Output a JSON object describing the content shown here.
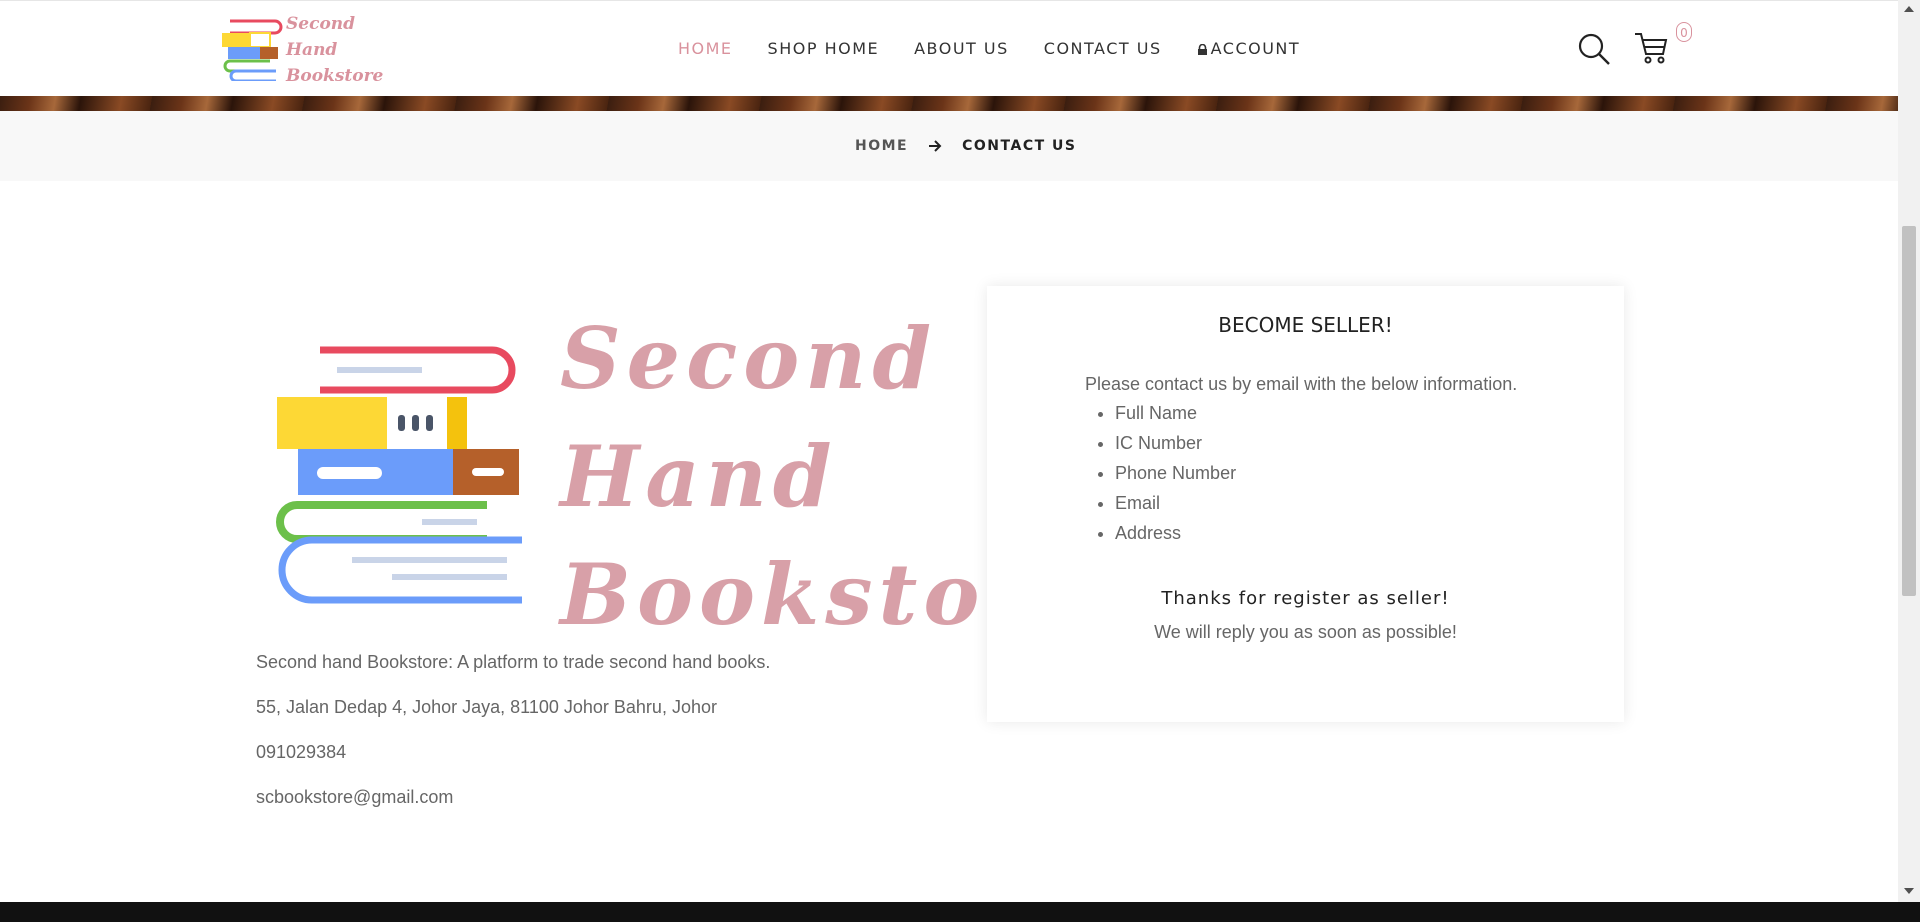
{
  "header": {
    "logo_lines": [
      "Second",
      "Hand",
      "Bookstore"
    ],
    "nav": [
      "HOME",
      "SHOP HOME",
      "ABOUT US",
      "CONTACT US",
      "ACCOUNT"
    ],
    "cart_count": "0"
  },
  "breadcrumb": {
    "home": "HOME",
    "current": "CONTACT US"
  },
  "main": {
    "logo_lines": [
      "Second",
      "Hand",
      "Bookstore"
    ],
    "description": "Second hand Bookstore: A platform to trade second hand books.",
    "address": "55, Jalan Dedap 4, Johor Jaya, 81100 Johor Bahru, Johor",
    "phone": "091029384",
    "email": "scbookstore@gmail.com"
  },
  "seller": {
    "title": "BECOME SELLER!",
    "intro": "Please contact us by email with the below information.",
    "items": [
      "Full Name",
      "IC Number",
      "Phone Number",
      "Email",
      "Address"
    ],
    "thanks": "Thanks for register as seller!",
    "reply": "We will reply you as soon as possible!"
  },
  "colors": {
    "accent": "#d9929d",
    "text": "#666666",
    "dark": "#222222"
  },
  "icons": [
    "search-icon",
    "cart-icon",
    "lock-icon",
    "arrow-right-icon",
    "books-stack-icon"
  ]
}
